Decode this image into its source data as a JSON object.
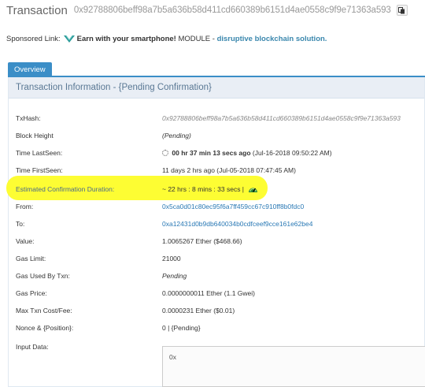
{
  "header": {
    "title": "Transaction",
    "tx_hash": "0x92788806beff98a7b5a636b58d411cd660389b6151d4ae0558c9f9e71363a593"
  },
  "sponsored": {
    "label": "Sponsored Link:",
    "headline": "Earn with your smartphone!",
    "middle": "MODULE -",
    "link_text": "disruptive blockchain solution."
  },
  "tabs": [
    {
      "label": "Overview",
      "active": true
    }
  ],
  "panel": {
    "title": "Transaction Information - {Pending Confirmation}"
  },
  "fields": {
    "txhash": {
      "label": "TxHash:",
      "value": "0x92788806beff98a7b5a636b58d411cd660389b6151d4ae0558c9f9e71363a593"
    },
    "block_height": {
      "label": "Block Height",
      "value": "(Pending)"
    },
    "last_seen": {
      "label": "Time LastSeen:",
      "value_bold": "00 hr 37 min 13 secs ago",
      "value_rest": "(Jul-16-2018 09:50:22 AM)"
    },
    "first_seen": {
      "label": "Time FirstSeen:",
      "value": "11 days 2 hrs ago (Jul-05-2018 07:47:45 AM)"
    },
    "est_duration": {
      "label": "Estimated Confirmation Duration:",
      "value": "~ 22 hrs : 8 mins : 33 secs |"
    },
    "from": {
      "label": "From:",
      "value": "0x5ca0d01c80ec95f6a7ff459cc67c910ff8b0fdc0"
    },
    "to": {
      "label": "To:",
      "value": "0xa12431d0b9db640034b0cdfceef9cce161e62be4"
    },
    "value": {
      "label": "Value:",
      "value": "1.0065267 Ether ($468.66)"
    },
    "gas_limit": {
      "label": "Gas Limit:",
      "value": "21000"
    },
    "gas_used": {
      "label": "Gas Used By Txn:",
      "value": "Pending"
    },
    "gas_price": {
      "label": "Gas Price:",
      "value": "0.0000000011 Ether (1.1 Gwei)"
    },
    "max_fee": {
      "label": "Max Txn Cost/Fee:",
      "value": "0.0000231 Ether ($0.01)"
    },
    "nonce": {
      "label": "Nonce & {Position}:",
      "value": "0 | {Pending}"
    },
    "input_data": {
      "label": "Input Data:",
      "value": "0x"
    }
  },
  "colors": {
    "accent": "#3b8ec7",
    "link": "#2a79b5",
    "highlight": "#fdfd33",
    "panel_header_bg": "#e9eef5"
  },
  "icons": {
    "copy": "copy-icon",
    "sponsor": "module-logo-icon",
    "spinner": "spinner-icon",
    "gauge": "speedometer-icon"
  }
}
